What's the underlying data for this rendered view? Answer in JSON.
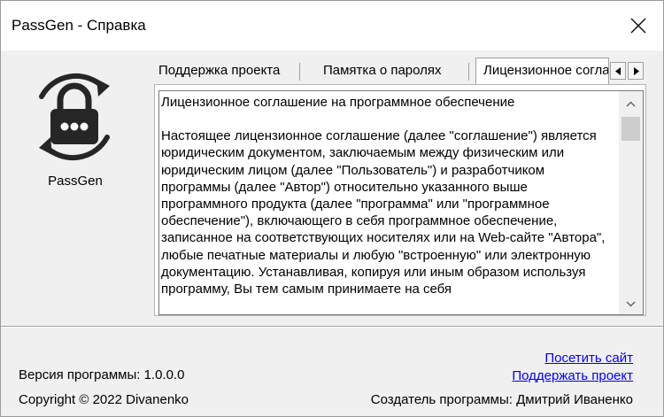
{
  "window": {
    "title": "PassGen - Справка"
  },
  "app": {
    "name": "PassGen",
    "logo_icon": "padlock-refresh-icon"
  },
  "tabs": [
    {
      "label": "Поддержка проекта",
      "active": false
    },
    {
      "label": "Памятка о паролях",
      "active": false
    },
    {
      "label": "Лицензионное соглашение",
      "active": true
    }
  ],
  "license": {
    "heading": "Лицензионное соглашение на программное обеспечение",
    "body": "Настоящее лицензионное соглашение (далее \"соглашение\") является юридическим документом, заключаемым между физическим или юридическим лицом (далее \"Пользователь\") и разработчиком программы  (далее \"Автор\") относительно указанного выше программного продукта (далее \"программа\" или \"программное обеспечение\"), включающего в себя программное обеспечение, записанное на соответствующих носителях или на Web-сайте \"Автора\", любые печатные материалы и любую \"встроенную\" или электронную документацию. Устанавливая, копируя или иным образом используя программу, Вы тем самым принимаете на себя"
  },
  "footer": {
    "version": "Версия программы: 1.0.0.0",
    "copyright": "Copyright © 2022 Divanenko",
    "visit_link": "Посетить сайт",
    "support_link": "Поддержать проект",
    "creator": "Создатель программы: Дмитрий Иваненко"
  },
  "colors": {
    "link": "#0000ff",
    "window_bg": "#f0f0f0",
    "logo_dark": "#262626"
  }
}
